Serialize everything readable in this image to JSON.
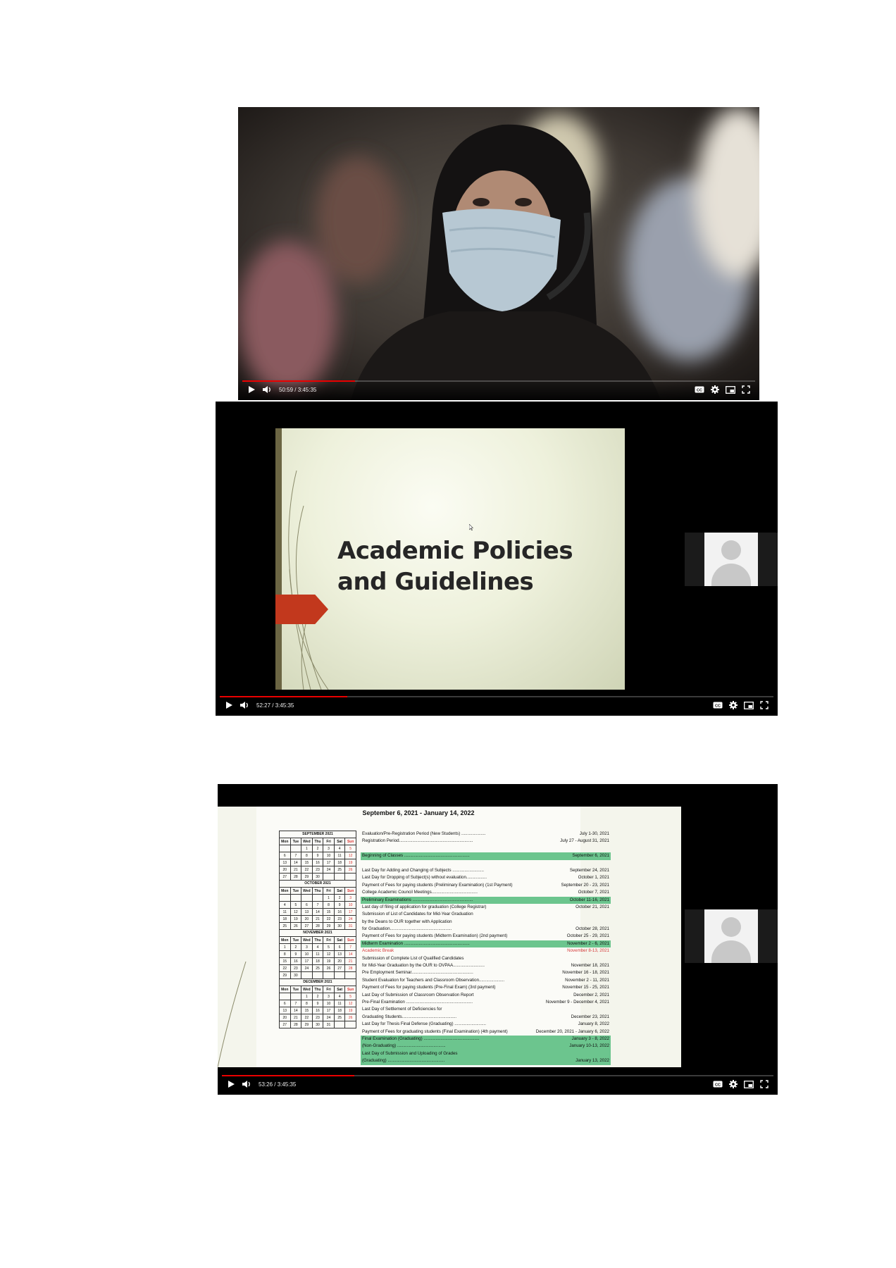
{
  "players": [
    {
      "id": "webcam",
      "time": "50:59 / 3:45:35",
      "progress": 0.22
    },
    {
      "id": "slide",
      "time": "52:27 / 3:45:35",
      "progress": 0.23,
      "slide_title_line1": "Academic Policies",
      "slide_title_line2": "and Guidelines"
    },
    {
      "id": "calendar",
      "time": "53:26 / 3:45:35",
      "progress": 0.24,
      "calendar_title": "September 6, 2021 - January 14,  2022"
    }
  ],
  "calendar": {
    "day_headers": [
      "Mon",
      "Tue",
      "Wed",
      "Thu",
      "Fri",
      "Sat",
      "Sun"
    ],
    "months": [
      {
        "name": "SEPTEMBER 2021",
        "weeks": [
          [
            "",
            "",
            "1",
            "2",
            "3",
            "4",
            "5"
          ],
          [
            "6",
            "7",
            "8",
            "9",
            "10",
            "11",
            "12"
          ],
          [
            "13",
            "14",
            "15",
            "16",
            "17",
            "18",
            "19"
          ],
          [
            "20",
            "21",
            "22",
            "23",
            "24",
            "25",
            "26"
          ],
          [
            "27",
            "28",
            "29",
            "30",
            "",
            "",
            ""
          ]
        ]
      },
      {
        "name": "OCTOBER 2021",
        "weeks": [
          [
            "",
            "",
            "",
            "",
            "1",
            "2",
            "3"
          ],
          [
            "4",
            "5",
            "6",
            "7",
            "8",
            "9",
            "10"
          ],
          [
            "11",
            "12",
            "13",
            "14",
            "15",
            "16",
            "17"
          ],
          [
            "18",
            "19",
            "20",
            "21",
            "22",
            "23",
            "24"
          ],
          [
            "25",
            "26",
            "27",
            "28",
            "29",
            "30",
            "31"
          ]
        ]
      },
      {
        "name": "NOVEMBER 2021",
        "weeks": [
          [
            "1",
            "2",
            "3",
            "4",
            "5",
            "6",
            "7"
          ],
          [
            "8",
            "9",
            "10",
            "11",
            "12",
            "13",
            "14"
          ],
          [
            "15",
            "16",
            "17",
            "18",
            "19",
            "20",
            "21"
          ],
          [
            "22",
            "23",
            "24",
            "25",
            "26",
            "27",
            "28"
          ],
          [
            "29",
            "30",
            "",
            "",
            "",
            "",
            ""
          ]
        ]
      },
      {
        "name": "DECEMBER 2021",
        "weeks": [
          [
            "",
            "",
            "1",
            "2",
            "3",
            "4",
            "5"
          ],
          [
            "6",
            "7",
            "8",
            "9",
            "10",
            "11",
            "12"
          ],
          [
            "13",
            "14",
            "15",
            "16",
            "17",
            "18",
            "19"
          ],
          [
            "20",
            "21",
            "22",
            "23",
            "24",
            "25",
            "26"
          ],
          [
            "27",
            "28",
            "29",
            "30",
            "31",
            "",
            ""
          ]
        ]
      }
    ],
    "events": [
      {
        "label": "Evaluation/Pre-Registration Period (New Students) ....................",
        "date": "July 1-30, 2021",
        "style": ""
      },
      {
        "label": "Registration Period.............................................................",
        "date": "July 27 - August 31, 2021",
        "style": ""
      },
      {
        "label": "",
        "date": "",
        "style": ""
      },
      {
        "label": "Beginning of Classes ......................................................",
        "date": "September 6, 2021",
        "style": "green"
      },
      {
        "label": "",
        "date": "",
        "style": ""
      },
      {
        "label": "Last Day for Adding and Changing of Subjects ..........................",
        "date": "September 24, 2021",
        "style": ""
      },
      {
        "label": "Last Day for Dropping of Subject(s) without evaluation.................",
        "date": "October 1, 2021",
        "style": ""
      },
      {
        "label": "Payment of Fees for paying students (Preliminary Examination) (1st Payment)",
        "date": "September 20 - 23, 2021",
        "style": ""
      },
      {
        "label": "College Academic Council Meetings......................................",
        "date": "October 7, 2021",
        "style": ""
      },
      {
        "label": "Preliminary Examinations ..................................................",
        "date": "October 11-16, 2021",
        "style": "green"
      },
      {
        "label": "Last day of filing of application for graduation (College Registrar)",
        "date": "October 21, 2021",
        "style": ""
      },
      {
        "label": "Submission of List of Candidates for Mid-Year Graduation",
        "date": "",
        "style": ""
      },
      {
        "label": "      by the Deans to OUR together with Application",
        "date": "",
        "style": ""
      },
      {
        "label": "      for Graduation...................................................",
        "date": "October 28, 2021",
        "style": ""
      },
      {
        "label": "Payment of Fees for paying students (Midterm Examination) (2nd payment)",
        "date": "October 25 - 29, 2021",
        "style": ""
      },
      {
        "label": "Midterm Examination ......................................................",
        "date": "November 2 - 6, 2021",
        "style": "green"
      },
      {
        "label": "Academic Break",
        "date": "November 8-13, 2021",
        "style": "red"
      },
      {
        "label": "Submission of Complete List of Qualified Candidates",
        "date": "",
        "style": ""
      },
      {
        "label": "      for Mid-Year Graduation by the OUR to OVPAA..........................",
        "date": "November 18, 2021",
        "style": ""
      },
      {
        "label": "Pre Employment Seminar...................................................",
        "date": "November 16 - 18, 2021",
        "style": ""
      },
      {
        "label": "Student Evaluation for Teachers and Classroom Observation.....................",
        "date": "November 2 - 11, 2021",
        "style": ""
      },
      {
        "label": "Payment of Fees for paying students (Pre-Final Exam) (3rd payment)",
        "date": "November 15 - 25, 2021",
        "style": ""
      },
      {
        "label": "Last Day of Submission of Classroom Observation Report",
        "date": "December 2, 2021",
        "style": ""
      },
      {
        "label": "Pre-Final Examination .......................................................",
        "date": "November 9 - December 4, 2021",
        "style": ""
      },
      {
        "label": "Last Day of Settlement of Deficiencies for",
        "date": "",
        "style": ""
      },
      {
        "label": "      Graduating Students.............................................",
        "date": "December 23, 2021",
        "style": ""
      },
      {
        "label": "Last Day for Thesis Final Defense (Graduating) ..........................",
        "date": "January 8, 2022",
        "style": ""
      },
      {
        "label": "Payment of Fees for graduating students (Final Examination) (4th payment)",
        "date": "December 20, 2021 - January 6, 2022",
        "style": ""
      },
      {
        "label": "Final Examination (Graduating) ..............................................",
        "date": "January 3 - 8, 2022",
        "style": "green"
      },
      {
        "label": "                    (Non-Graduating) ........................................",
        "date": "January 10-13, 2022",
        "style": "green"
      },
      {
        "label": "Last Day of Submission and Uploading of Grades",
        "date": "",
        "style": "green"
      },
      {
        "label": "                    (Graduating) ...............................................",
        "date": "January 13, 2022",
        "style": "green"
      }
    ]
  },
  "icons": {
    "play": "play-icon",
    "volume": "volume-icon",
    "captions": "captions-icon",
    "settings": "gear-icon",
    "miniplayer": "miniplayer-icon",
    "fullscreen": "fullscreen-icon"
  },
  "colors": {
    "progress": "#ff0000",
    "highlight_green": "#6cc58e",
    "break_red": "#d53b3b",
    "slide_arrow": "#c2381d"
  }
}
